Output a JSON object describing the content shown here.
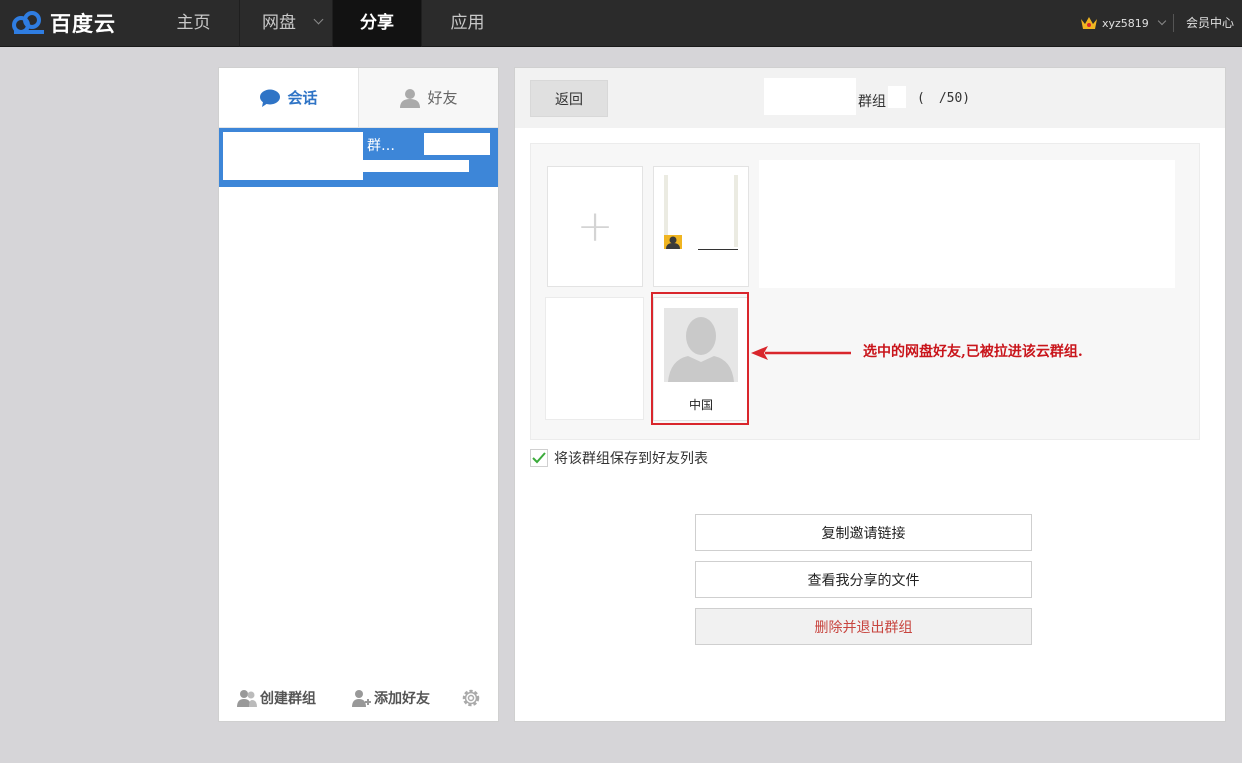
{
  "topbar": {
    "logo_text": "百度云",
    "nav": [
      {
        "label": "主页",
        "active": false
      },
      {
        "label": "网盘",
        "active": false,
        "has_dropdown": true
      },
      {
        "label": "分享",
        "active": true
      },
      {
        "label": "应用",
        "active": false
      }
    ],
    "username": "xyz5819",
    "vip_center": "会员中心",
    "icons": [
      "baidu-cloud-logo-icon",
      "crown-icon",
      "chevron-down-icon"
    ]
  },
  "left_panel": {
    "tabs": [
      {
        "label": "会话",
        "icon": "chat-bubble-icon",
        "active": true
      },
      {
        "label": "好友",
        "icon": "person-icon",
        "active": false
      }
    ],
    "conversations": [
      {
        "name": "群…",
        "selected": true
      }
    ],
    "footer": {
      "create_group": "创建群组",
      "add_friend": "添加好友",
      "settings_icon": "gear-icon"
    }
  },
  "right_panel": {
    "back_label": "返回",
    "title": "群组",
    "open_paren": "(",
    "member_count": "/50)",
    "members": [
      {
        "name": "中国",
        "highlighted": true
      }
    ],
    "add_member_symbol": "+",
    "annotation": "选中的网盘好友,已被拉进该云群组.",
    "save_checkbox": {
      "label": "将该群组保存到好友列表",
      "checked": true
    },
    "actions": {
      "copy_invite": "复制邀请链接",
      "view_shared": "查看我分享的文件",
      "delete_exit": "删除并退出群组"
    }
  },
  "colors": {
    "topbar_bg": "#2b2b2b",
    "accent_blue": "#3d86d8",
    "annotation_red": "#c9151b",
    "danger_text": "#c8453f"
  }
}
